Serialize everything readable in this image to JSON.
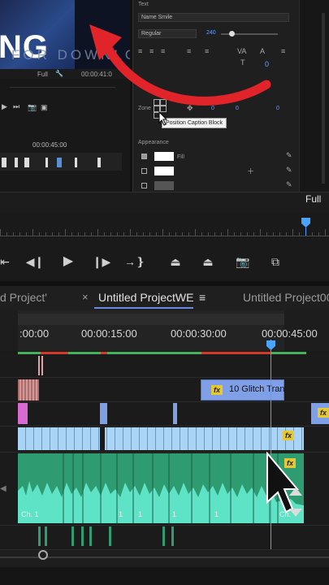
{
  "essential_graphics": {
    "text_section_label": "Text",
    "font_name": "Name Smile",
    "font_style": "Regular",
    "font_size": "240",
    "align_label": "Align",
    "zone_label": "Zone",
    "zone_values": [
      "0",
      "0",
      "0"
    ],
    "appearance_label": "Appearance",
    "fill_label": "Fill"
  },
  "tooltip": "Position Caption Block",
  "preview": {
    "big_text": "NG",
    "overlay_text": "FOR DOWNLOAD",
    "fit_label": "Full",
    "timecode": "00:00:41:0",
    "source_timecode": "00:00:45:00"
  },
  "program_monitor": {
    "resolution_select": "Full"
  },
  "timeline": {
    "tabs": [
      {
        "label": "d Project'",
        "close": ""
      },
      {
        "label": "Untitled ProjectWE",
        "close": "×",
        "menu": "≡"
      },
      {
        "label": "Untitled Project00",
        "close": ""
      }
    ],
    "ruler_timecodes": [
      ":00:00",
      "00:00:15:00",
      "00:00:30:00",
      "00:00:45:00"
    ],
    "transition_label": "10 Glitch Tran",
    "fx_label": "fx",
    "channel_labels": [
      "Ch. 1",
      "1",
      "1",
      "1",
      "1",
      "Ch."
    ]
  },
  "colors": {
    "accent_blue": "#4aa3ff",
    "annotation_red": "#e0242a",
    "audio_green": "#2fb58a",
    "video_blue": "#a9d4f5",
    "transition_blue": "#7f9fe6"
  }
}
